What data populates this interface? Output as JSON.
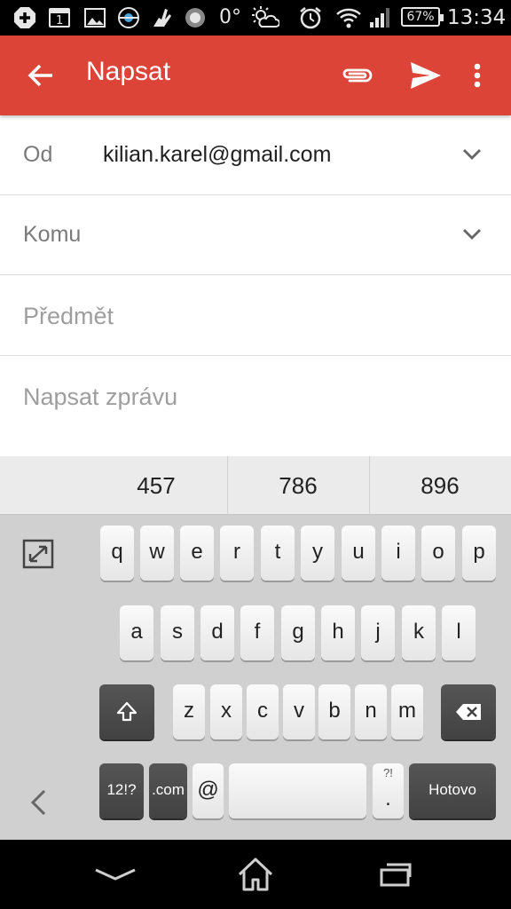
{
  "status_bar": {
    "icons": [
      "plus-notification-icon",
      "calendar-icon",
      "image-icon",
      "game-icon",
      "hand-icon",
      "record-icon"
    ],
    "calendar_day": "1",
    "temperature": "0°",
    "weather_icon": "partly-sunny-icon",
    "alarm_icon": "alarm-clock-icon",
    "wifi_icon": "wifi-icon",
    "signal_icon": "signal-icon",
    "battery": "67%",
    "time": "13:34"
  },
  "app_bar": {
    "title": "Napsat",
    "color": "#db4437"
  },
  "compose": {
    "from_label": "Od",
    "from_value": "kilian.karel@gmail.com",
    "to_label": "Komu",
    "subject_placeholder": "Předmět",
    "body_placeholder": "Napsat zprávu"
  },
  "keyboard": {
    "suggestions": [
      "457",
      "786",
      "896"
    ],
    "row1": [
      "q",
      "w",
      "e",
      "r",
      "t",
      "y",
      "u",
      "i",
      "o",
      "p"
    ],
    "row2": [
      "a",
      "s",
      "d",
      "f",
      "g",
      "h",
      "j",
      "k",
      "l"
    ],
    "row3": [
      "z",
      "x",
      "c",
      "v",
      "b",
      "n",
      "m"
    ],
    "symbols_key": "12!?",
    "com_key": ".com",
    "at_key": "@",
    "period_key": ".",
    "period_sup": "?!",
    "done_key": "Hotovo"
  }
}
